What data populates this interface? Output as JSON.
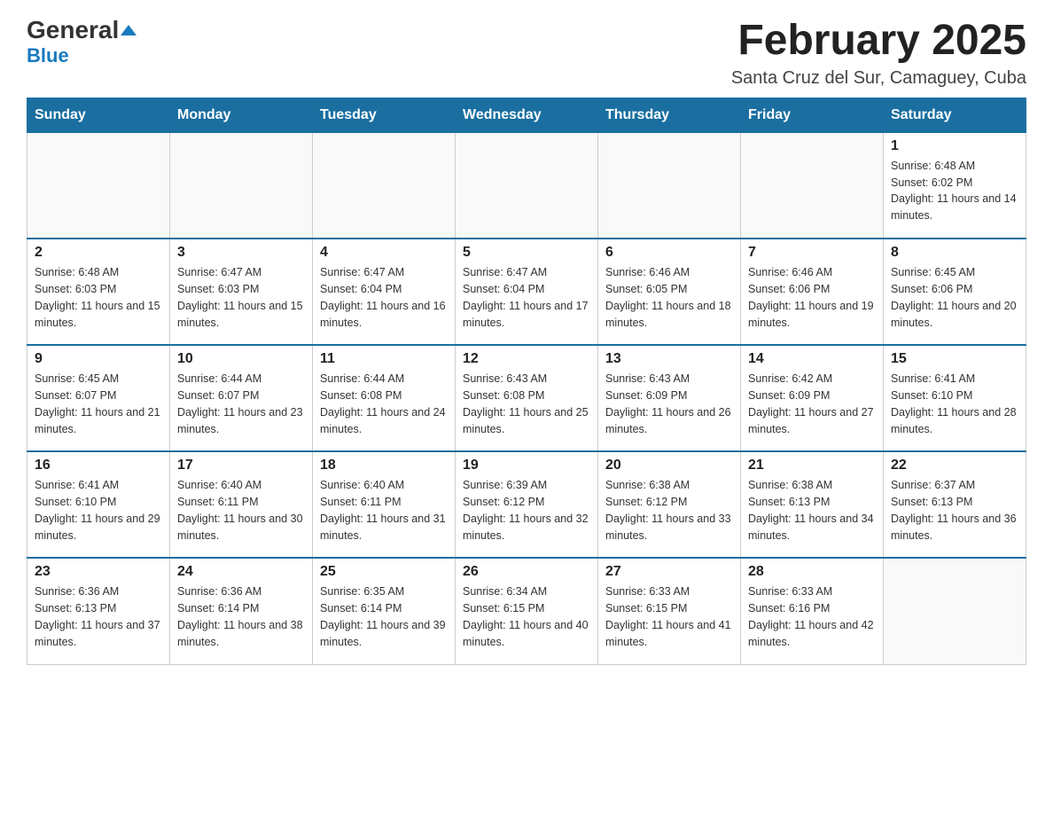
{
  "header": {
    "logo_general": "General",
    "logo_blue": "Blue",
    "title": "February 2025",
    "subtitle": "Santa Cruz del Sur, Camaguey, Cuba"
  },
  "days_of_week": [
    "Sunday",
    "Monday",
    "Tuesday",
    "Wednesday",
    "Thursday",
    "Friday",
    "Saturday"
  ],
  "weeks": [
    [
      {
        "day": "",
        "info": ""
      },
      {
        "day": "",
        "info": ""
      },
      {
        "day": "",
        "info": ""
      },
      {
        "day": "",
        "info": ""
      },
      {
        "day": "",
        "info": ""
      },
      {
        "day": "",
        "info": ""
      },
      {
        "day": "1",
        "info": "Sunrise: 6:48 AM\nSunset: 6:02 PM\nDaylight: 11 hours and 14 minutes."
      }
    ],
    [
      {
        "day": "2",
        "info": "Sunrise: 6:48 AM\nSunset: 6:03 PM\nDaylight: 11 hours and 15 minutes."
      },
      {
        "day": "3",
        "info": "Sunrise: 6:47 AM\nSunset: 6:03 PM\nDaylight: 11 hours and 15 minutes."
      },
      {
        "day": "4",
        "info": "Sunrise: 6:47 AM\nSunset: 6:04 PM\nDaylight: 11 hours and 16 minutes."
      },
      {
        "day": "5",
        "info": "Sunrise: 6:47 AM\nSunset: 6:04 PM\nDaylight: 11 hours and 17 minutes."
      },
      {
        "day": "6",
        "info": "Sunrise: 6:46 AM\nSunset: 6:05 PM\nDaylight: 11 hours and 18 minutes."
      },
      {
        "day": "7",
        "info": "Sunrise: 6:46 AM\nSunset: 6:06 PM\nDaylight: 11 hours and 19 minutes."
      },
      {
        "day": "8",
        "info": "Sunrise: 6:45 AM\nSunset: 6:06 PM\nDaylight: 11 hours and 20 minutes."
      }
    ],
    [
      {
        "day": "9",
        "info": "Sunrise: 6:45 AM\nSunset: 6:07 PM\nDaylight: 11 hours and 21 minutes."
      },
      {
        "day": "10",
        "info": "Sunrise: 6:44 AM\nSunset: 6:07 PM\nDaylight: 11 hours and 23 minutes."
      },
      {
        "day": "11",
        "info": "Sunrise: 6:44 AM\nSunset: 6:08 PM\nDaylight: 11 hours and 24 minutes."
      },
      {
        "day": "12",
        "info": "Sunrise: 6:43 AM\nSunset: 6:08 PM\nDaylight: 11 hours and 25 minutes."
      },
      {
        "day": "13",
        "info": "Sunrise: 6:43 AM\nSunset: 6:09 PM\nDaylight: 11 hours and 26 minutes."
      },
      {
        "day": "14",
        "info": "Sunrise: 6:42 AM\nSunset: 6:09 PM\nDaylight: 11 hours and 27 minutes."
      },
      {
        "day": "15",
        "info": "Sunrise: 6:41 AM\nSunset: 6:10 PM\nDaylight: 11 hours and 28 minutes."
      }
    ],
    [
      {
        "day": "16",
        "info": "Sunrise: 6:41 AM\nSunset: 6:10 PM\nDaylight: 11 hours and 29 minutes."
      },
      {
        "day": "17",
        "info": "Sunrise: 6:40 AM\nSunset: 6:11 PM\nDaylight: 11 hours and 30 minutes."
      },
      {
        "day": "18",
        "info": "Sunrise: 6:40 AM\nSunset: 6:11 PM\nDaylight: 11 hours and 31 minutes."
      },
      {
        "day": "19",
        "info": "Sunrise: 6:39 AM\nSunset: 6:12 PM\nDaylight: 11 hours and 32 minutes."
      },
      {
        "day": "20",
        "info": "Sunrise: 6:38 AM\nSunset: 6:12 PM\nDaylight: 11 hours and 33 minutes."
      },
      {
        "day": "21",
        "info": "Sunrise: 6:38 AM\nSunset: 6:13 PM\nDaylight: 11 hours and 34 minutes."
      },
      {
        "day": "22",
        "info": "Sunrise: 6:37 AM\nSunset: 6:13 PM\nDaylight: 11 hours and 36 minutes."
      }
    ],
    [
      {
        "day": "23",
        "info": "Sunrise: 6:36 AM\nSunset: 6:13 PM\nDaylight: 11 hours and 37 minutes."
      },
      {
        "day": "24",
        "info": "Sunrise: 6:36 AM\nSunset: 6:14 PM\nDaylight: 11 hours and 38 minutes."
      },
      {
        "day": "25",
        "info": "Sunrise: 6:35 AM\nSunset: 6:14 PM\nDaylight: 11 hours and 39 minutes."
      },
      {
        "day": "26",
        "info": "Sunrise: 6:34 AM\nSunset: 6:15 PM\nDaylight: 11 hours and 40 minutes."
      },
      {
        "day": "27",
        "info": "Sunrise: 6:33 AM\nSunset: 6:15 PM\nDaylight: 11 hours and 41 minutes."
      },
      {
        "day": "28",
        "info": "Sunrise: 6:33 AM\nSunset: 6:16 PM\nDaylight: 11 hours and 42 minutes."
      },
      {
        "day": "",
        "info": ""
      }
    ]
  ]
}
